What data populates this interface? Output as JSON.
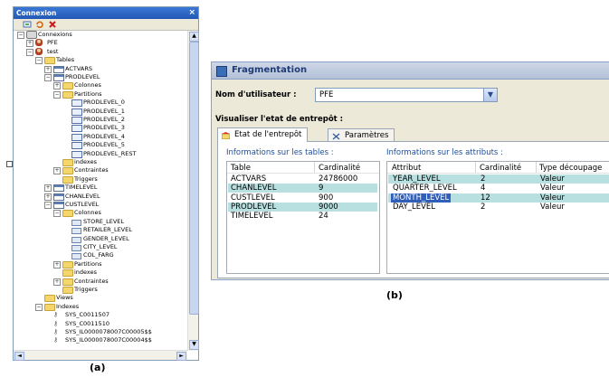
{
  "panel_a": {
    "title": "Connexion",
    "close_glyph": "×",
    "toolbar": [
      "connect-icon",
      "refresh-icon",
      "disconnect-icon"
    ],
    "caption": "(a)",
    "tree": [
      {
        "d": 0,
        "exp": "−",
        "icon": "db",
        "label": "Connexions"
      },
      {
        "d": 1,
        "exp": "+",
        "icon": "user",
        "label": "PFE"
      },
      {
        "d": 1,
        "exp": "−",
        "icon": "user",
        "label": "test"
      },
      {
        "d": 2,
        "exp": "−",
        "icon": "folder",
        "label": "Tables"
      },
      {
        "d": 3,
        "exp": "+",
        "icon": "table",
        "label": "ACTVARS"
      },
      {
        "d": 3,
        "exp": "−",
        "icon": "table",
        "label": "PRODLEVEL"
      },
      {
        "d": 4,
        "exp": "+",
        "icon": "folder",
        "label": "Colonnes"
      },
      {
        "d": 4,
        "exp": "−",
        "icon": "folder",
        "label": "Partitions"
      },
      {
        "d": 5,
        "exp": "",
        "icon": "part",
        "label": "PRODLEVEL_0"
      },
      {
        "d": 5,
        "exp": "",
        "icon": "part",
        "label": "PRODLEVEL_1"
      },
      {
        "d": 5,
        "exp": "",
        "icon": "part",
        "label": "PRODLEVEL_2"
      },
      {
        "d": 5,
        "exp": "",
        "icon": "part",
        "label": "PRODLEVEL_3"
      },
      {
        "d": 5,
        "exp": "",
        "icon": "part",
        "label": "PRODLEVEL_4"
      },
      {
        "d": 5,
        "exp": "",
        "icon": "part",
        "label": "PRODLEVEL_5"
      },
      {
        "d": 5,
        "exp": "",
        "icon": "part",
        "label": "PRODLEVEL_REST"
      },
      {
        "d": 4,
        "exp": "",
        "icon": "folder",
        "label": "indexes"
      },
      {
        "d": 4,
        "exp": "+",
        "icon": "folder",
        "label": "Contraintes"
      },
      {
        "d": 4,
        "exp": "",
        "icon": "folder",
        "label": "Triggers"
      },
      {
        "d": 3,
        "exp": "+",
        "icon": "table",
        "label": "TIMELEVEL"
      },
      {
        "d": 3,
        "exp": "+",
        "icon": "table",
        "label": "CHANLEVEL"
      },
      {
        "d": 3,
        "exp": "−",
        "icon": "table",
        "label": "CUSTLEVEL"
      },
      {
        "d": 4,
        "exp": "−",
        "icon": "folder",
        "label": "Colonnes"
      },
      {
        "d": 5,
        "exp": "",
        "icon": "col",
        "label": "STORE_LEVEL"
      },
      {
        "d": 5,
        "exp": "",
        "icon": "col",
        "label": "RETAILER_LEVEL"
      },
      {
        "d": 5,
        "exp": "",
        "icon": "col",
        "label": "GENDER_LEVEL"
      },
      {
        "d": 5,
        "exp": "",
        "icon": "col",
        "label": "CITY_LEVEL"
      },
      {
        "d": 5,
        "exp": "",
        "icon": "col",
        "label": "COL_FARG"
      },
      {
        "d": 4,
        "exp": "+",
        "icon": "folder",
        "label": "Partitions"
      },
      {
        "d": 4,
        "exp": "",
        "icon": "folder",
        "label": "indexes"
      },
      {
        "d": 4,
        "exp": "+",
        "icon": "folder",
        "label": "Contraintes"
      },
      {
        "d": 4,
        "exp": "",
        "icon": "folder",
        "label": "Triggers"
      },
      {
        "d": 2,
        "exp": "",
        "icon": "folder",
        "label": "Views"
      },
      {
        "d": 2,
        "exp": "−",
        "icon": "folder",
        "label": "Indexes"
      },
      {
        "d": 3,
        "exp": "",
        "icon": "key",
        "label": "SYS_C0011507"
      },
      {
        "d": 3,
        "exp": "",
        "icon": "key",
        "label": "SYS_C0011510"
      },
      {
        "d": 3,
        "exp": "",
        "icon": "key",
        "label": "SYS_IL0000078007C00005$$"
      },
      {
        "d": 3,
        "exp": "",
        "icon": "key",
        "label": "SYS_IL0000078007C00004$$"
      }
    ]
  },
  "panel_b": {
    "title": "Fragmentation",
    "user_label": "Nom d'utilisateur :",
    "user_value": "PFE",
    "state_label": "Visualiser l'etat de entrepôt :",
    "tabs": [
      "Etat de l'entrepôt",
      "Paramètres"
    ],
    "tables_section": "Informations sur les  tables :",
    "attrs_section": "Informations sur les  attributs :",
    "tables_headers": [
      "Table",
      "Cardinalité"
    ],
    "tables_rows": [
      {
        "name": "ACTVARS",
        "card": "24786000",
        "hl": false
      },
      {
        "name": "CHANLEVEL",
        "card": "9",
        "hl": true
      },
      {
        "name": "CUSTLEVEL",
        "card": "900",
        "hl": false
      },
      {
        "name": "PRODLEVEL",
        "card": "9000",
        "hl": true
      },
      {
        "name": "TIMELEVEL",
        "card": "24",
        "hl": false
      }
    ],
    "attrs_headers": [
      "Attribut",
      "Cardinalité",
      "Type découpage"
    ],
    "attrs_rows": [
      {
        "name": "YEAR_LEVEL",
        "card": "2",
        "type": "Valeur",
        "hl": true,
        "sel": false
      },
      {
        "name": "QUARTER_LEVEL",
        "card": "4",
        "type": "Valeur",
        "hl": false,
        "sel": false
      },
      {
        "name": "MONTH_LEVEL",
        "card": "12",
        "type": "Valeur",
        "hl": true,
        "sel": true
      },
      {
        "name": "DAY_LEVEL",
        "card": "2",
        "type": "Valeur",
        "hl": false,
        "sel": false
      }
    ],
    "caption": "(b)"
  },
  "colors": {
    "highlight": "#b8e0e0",
    "selection": "#2f5fb8",
    "section_text": "#1e4d9a"
  }
}
